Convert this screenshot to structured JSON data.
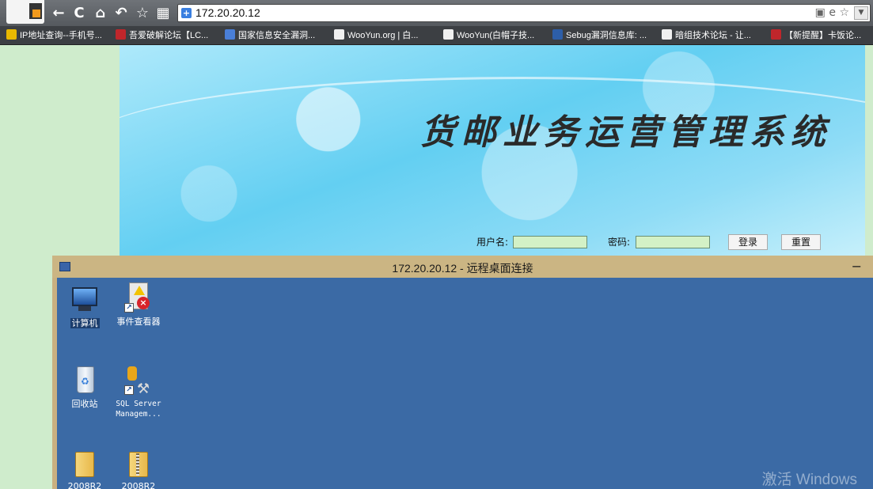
{
  "browser": {
    "url": "172.20.20.12",
    "nav_icons": [
      "back-icon",
      "refresh-icon",
      "home-icon",
      "undo-icon",
      "star-icon",
      "apps-icon"
    ],
    "url_tools": [
      "qr-icon",
      "ie-icon",
      "favorite-star-icon"
    ],
    "bookmarks": [
      {
        "label": "IP地址查询--手机号...",
        "color": "#e8b800"
      },
      {
        "label": "吾爱破解论坛【LC...",
        "color": "#c0262b"
      },
      {
        "label": "国家信息安全漏洞...",
        "color": "#4a7fd8"
      },
      {
        "label": "WooYun.org | 白...",
        "color": "#333333"
      },
      {
        "label": "WooYun(白帽子技...",
        "color": "#333333"
      },
      {
        "label": "Sebug漏洞信息库: ...",
        "color": "#2d5ea8"
      },
      {
        "label": "暗组技术论坛 - 让...",
        "color": "#222222"
      },
      {
        "label": "【新提醒】卡饭论...",
        "color": "#c0262b"
      }
    ]
  },
  "banner": {
    "title": "货邮业务运营管理系统",
    "username_label": "用户名:",
    "password_label": "密码:",
    "login_button": "登录",
    "reset_button": "重置"
  },
  "rdp": {
    "title": "172.20.20.12 - 远程桌面连接",
    "minimize": "−",
    "desktop_icons": [
      {
        "label": "计算机"
      },
      {
        "label": "事件查看器"
      },
      {
        "label": "回收站"
      },
      {
        "label": "SQL Server Managem..."
      },
      {
        "label": "2008R2"
      },
      {
        "label": "2008R2"
      }
    ],
    "watermark": "激活 Windows"
  }
}
